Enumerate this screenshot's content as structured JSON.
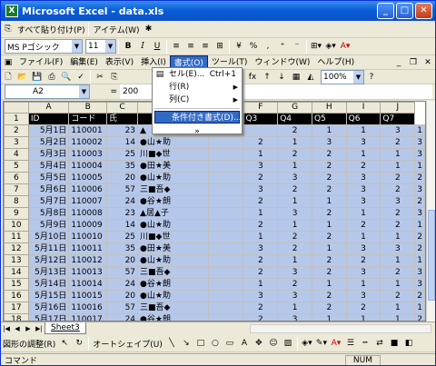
{
  "window": {
    "title": "Microsoft Excel - data.xls"
  },
  "toolbar1": {
    "paste_all": "すべて貼り付け(P)",
    "items": "アイテム(W)"
  },
  "format_bar": {
    "font": "MS Pゴシック",
    "size": "11"
  },
  "menu": [
    "ファイル(F)",
    "編集(E)",
    "表示(V)",
    "挿入(I)",
    "書式(O)",
    "ツール(T)",
    "ウィンドウ(W)",
    "ヘルプ(H)"
  ],
  "dropdown": {
    "cell": "セル(E)...",
    "cell_shortcut": "Ctrl+1",
    "row": "行(R)",
    "column": "列(C)",
    "conditional": "条件付き書式(D)...",
    "more": "»"
  },
  "standard_bar": {
    "zoom": "100%"
  },
  "formula_bar": {
    "name_box": "A2",
    "equals": "=",
    "value": "200"
  },
  "grid": {
    "columns": [
      "A",
      "B",
      "C",
      "D",
      "E",
      "F",
      "G",
      "H",
      "I",
      "J"
    ],
    "row1": [
      "",
      "ID",
      "コード",
      "氏",
      "",
      "",
      "Q3",
      "Q4",
      "Q5",
      "Q6",
      "Q7"
    ],
    "rows": [
      [
        "2",
        "5月1日",
        "110001",
        "23",
        "▲",
        "",
        "",
        "2",
        "1",
        "1",
        "3",
        "1"
      ],
      [
        "3",
        "5月2日",
        "110002",
        "14",
        "●山★助",
        "",
        "2",
        "1",
        "3",
        "3",
        "2",
        "3"
      ],
      [
        "4",
        "5月3日",
        "110003",
        "25",
        "川■◆世",
        "",
        "1",
        "2",
        "2",
        "1",
        "1",
        "3"
      ],
      [
        "5",
        "5月4日",
        "110004",
        "35",
        "●田★美",
        "",
        "3",
        "1",
        "2",
        "2",
        "1",
        "1"
      ],
      [
        "6",
        "5月5日",
        "110005",
        "20",
        "●山★助",
        "",
        "2",
        "3",
        "2",
        "3",
        "2",
        "2"
      ],
      [
        "7",
        "5月6日",
        "110006",
        "57",
        "三■吾◆",
        "",
        "3",
        "2",
        "2",
        "3",
        "2",
        "3"
      ],
      [
        "8",
        "5月7日",
        "110007",
        "24",
        "●谷★朗",
        "",
        "2",
        "1",
        "1",
        "3",
        "3",
        "2"
      ],
      [
        "9",
        "5月8日",
        "110008",
        "23",
        "▲居▲子",
        "",
        "1",
        "3",
        "2",
        "1",
        "2",
        "3"
      ],
      [
        "10",
        "5月9日",
        "110009",
        "14",
        "●山★助",
        "",
        "2",
        "1",
        "1",
        "2",
        "2",
        "1"
      ],
      [
        "11",
        "5月10日",
        "110010",
        "25",
        "川■◆世",
        "",
        "1",
        "2",
        "2",
        "1",
        "1",
        "2"
      ],
      [
        "12",
        "5月11日",
        "110011",
        "35",
        "●田★美",
        "",
        "3",
        "2",
        "1",
        "3",
        "3",
        "2"
      ],
      [
        "13",
        "5月12日",
        "110012",
        "20",
        "●山★助",
        "",
        "2",
        "1",
        "2",
        "2",
        "1",
        "1"
      ],
      [
        "14",
        "5月13日",
        "110013",
        "57",
        "三■吾◆",
        "",
        "2",
        "3",
        "2",
        "3",
        "2",
        "3"
      ],
      [
        "15",
        "5月14日",
        "110014",
        "24",
        "●谷★朗",
        "",
        "1",
        "2",
        "1",
        "1",
        "1",
        "3"
      ],
      [
        "16",
        "5月15日",
        "110015",
        "20",
        "●山★助",
        "",
        "3",
        "3",
        "2",
        "3",
        "2",
        "2"
      ],
      [
        "17",
        "5月16日",
        "110016",
        "57",
        "三■吾◆",
        "",
        "2",
        "1",
        "2",
        "2",
        "1",
        "1"
      ],
      [
        "18",
        "5月17日",
        "110017",
        "24",
        "●谷★朗",
        "",
        "2",
        "3",
        "1",
        "1",
        "1",
        "2"
      ]
    ]
  },
  "sheet_tab": "Sheet3",
  "draw_bar": {
    "draw": "図形の調整(R)",
    "autoshape": "オートシェイプ(U)"
  },
  "status": {
    "left": "コマンド",
    "num": "NUM"
  }
}
